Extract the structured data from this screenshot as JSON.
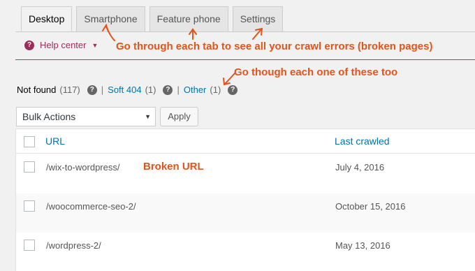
{
  "tabs": [
    {
      "label": "Desktop",
      "active": true
    },
    {
      "label": "Smartphone",
      "active": false
    },
    {
      "label": "Feature phone",
      "active": false
    },
    {
      "label": "Settings",
      "active": false
    }
  ],
  "help": {
    "label": "Help center",
    "icon": "question-circle-icon"
  },
  "annotations": {
    "tabs_note": "Go through each tab to see all your crawl errors (broken pages)",
    "filters_note": "Go though each one of these too",
    "broken_url_note": "Broken URL",
    "color": "#e2541b"
  },
  "filters": [
    {
      "label": "Not found",
      "count": "(117)",
      "current": true
    },
    {
      "label": "Soft 404",
      "count": "(1)",
      "current": false
    },
    {
      "label": "Other",
      "count": "(1)",
      "current": false
    }
  ],
  "bulk_actions": {
    "selected": "Bulk Actions",
    "apply_label": "Apply"
  },
  "table": {
    "columns": [
      "URL",
      "Last crawled"
    ],
    "rows": [
      {
        "url": "/wix-to-wordpress/",
        "last_crawled": "July 4, 2016"
      },
      {
        "url": "/woocommerce-seo-2/",
        "last_crawled": "October 15, 2016"
      },
      {
        "url": "/wordpress-2/",
        "last_crawled": "May 13, 2016"
      }
    ]
  }
}
